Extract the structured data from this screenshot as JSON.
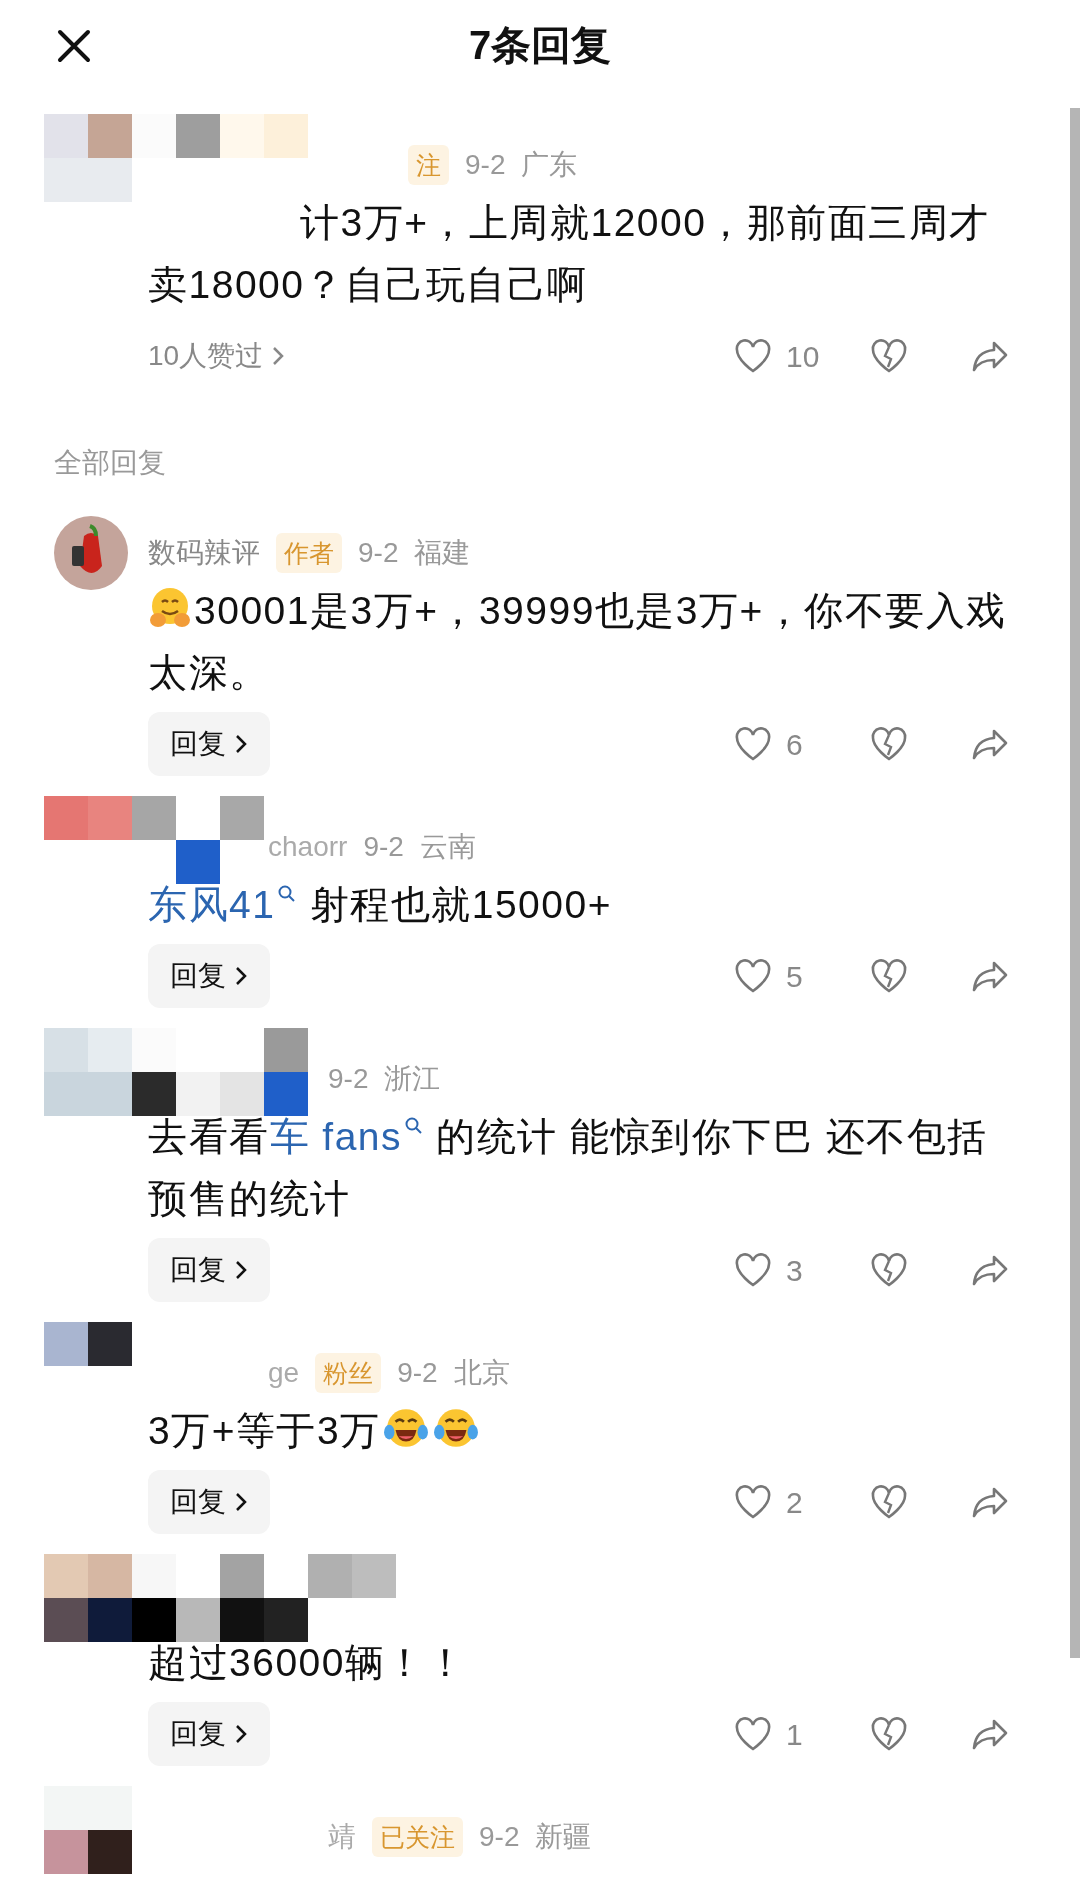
{
  "header": {
    "title": "7条回复"
  },
  "section_label": "全部回复",
  "comments": [
    {
      "redacted": true,
      "badge": "注",
      "date": "9-2",
      "region": "广东",
      "indent": true,
      "body": [
        {
          "kind": "text",
          "text": "计3万+，上周就12000，那前面三周才卖18000？自己玩自己啊"
        }
      ],
      "footer": {
        "kind": "likers",
        "label": "10人赞过"
      },
      "likes": "10"
    },
    {
      "redacted": false,
      "name": "数码辣评",
      "badge": "作者",
      "date": "9-2",
      "region": "福建",
      "body": [
        {
          "kind": "hug"
        },
        {
          "kind": "text",
          "text": "30001是3万+，39999也是3万+，你不要入戏太深。"
        }
      ],
      "footer": {
        "kind": "reply",
        "label": "回复"
      },
      "likes": "6"
    },
    {
      "redacted": true,
      "name": "chaorr",
      "date": "9-2",
      "region": "云南",
      "body": [
        {
          "kind": "link",
          "text": "东风41"
        },
        {
          "kind": "text",
          "text": " 射程也就15000+"
        }
      ],
      "footer": {
        "kind": "reply",
        "label": "回复"
      },
      "likes": "5"
    },
    {
      "redacted": true,
      "date": "9-2",
      "region": "浙江",
      "body": [
        {
          "kind": "text",
          "text": "去看看"
        },
        {
          "kind": "link",
          "text": "车 fans"
        },
        {
          "kind": "text",
          "text": " 的统计 能惊到你下巴 还不包括预售的统计"
        }
      ],
      "footer": {
        "kind": "reply",
        "label": "回复"
      },
      "likes": "3"
    },
    {
      "redacted": true,
      "name": "ge",
      "badge": "粉丝",
      "date": "9-2",
      "region": "北京",
      "body": [
        {
          "kind": "text",
          "text": "3万+等于3万"
        },
        {
          "kind": "laugh"
        },
        {
          "kind": "laugh"
        }
      ],
      "footer": {
        "kind": "reply",
        "label": "回复"
      },
      "likes": "2"
    },
    {
      "redacted": true,
      "body": [
        {
          "kind": "text",
          "text": "超过36000辆！！"
        }
      ],
      "footer": {
        "kind": "reply",
        "label": "回复"
      },
      "likes": "1"
    },
    {
      "redacted": true,
      "name": "靖",
      "badge": "已关注",
      "date": "9-2",
      "region": "新疆"
    }
  ]
}
